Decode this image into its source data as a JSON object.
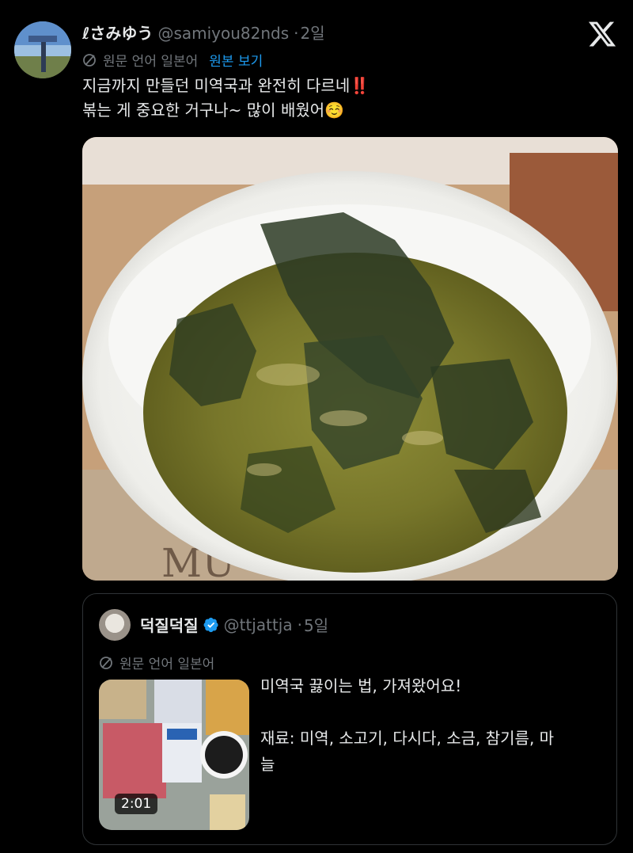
{
  "tweet": {
    "display_name": "ℓさみゆう",
    "handle": "@samiyou82nds",
    "age": "2일",
    "translation_note": "원문 언어 일본어",
    "view_original": "원본 보기",
    "text_line1": "지금까지 만들던 미역국과 완전히 다르네‼️",
    "text_line2": "볶는 게 중요한 거구나~ 많이 배웠어☺️"
  },
  "quote": {
    "display_name": "덕질덕질",
    "handle": "@ttjattja",
    "age": "5일",
    "translation_note": "원문 언어 일본어",
    "video_duration": "2:01",
    "text_line1": "미역국 끓이는 법, 가져왔어요!",
    "text_line2": "",
    "text_line3": "재료: 미역, 소고기, 다시다, 소금, 참기름, 마",
    "text_line4": "늘"
  },
  "icons": {
    "app_logo": "x-logo-icon",
    "translate": "globe-slash-icon",
    "verified": "verified-badge-icon"
  },
  "colors": {
    "background": "#000000",
    "text": "#e7e9ea",
    "muted": "#71767b",
    "link": "#1d9bf0",
    "border": "#2f3336"
  }
}
